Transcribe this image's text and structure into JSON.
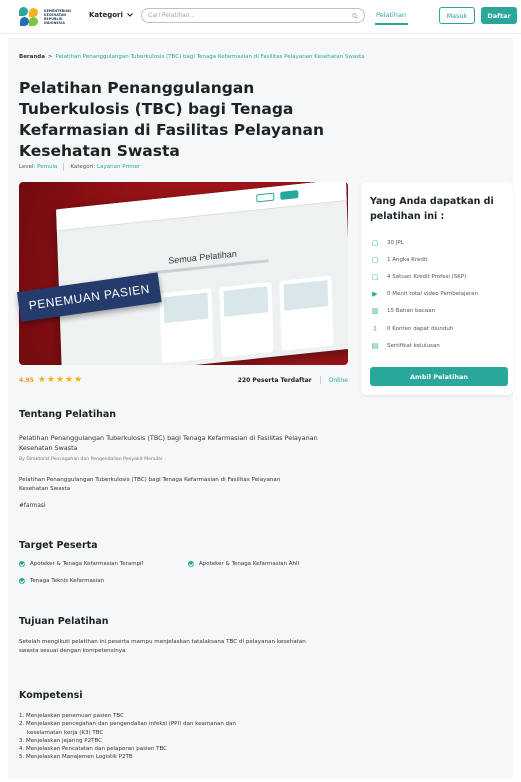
{
  "header": {
    "logo_lines": [
      "KEMENTERIAN",
      "KESEHATAN",
      "REPUBLIK",
      "INDONESIA"
    ],
    "kategori_label": "Kategori",
    "search_placeholder": "Cari Pelatihan...",
    "nav_pelatihan": "Pelatihan",
    "masuk": "Masuk",
    "daftar": "Daftar"
  },
  "breadcrumb": {
    "home": "Beranda",
    "separator": ">",
    "current": "Pelatihan Penanggulangan Tuberkulosis (TBC) bagi Tenaga Kefarmasian di Fasilitas Pelayanan Kesehatan Swasta"
  },
  "course": {
    "title": "Pelatihan Penanggulangan Tuberkulosis (TBC) bagi Tenaga Kefarmasian di Fasilitas Pelayanan Kesehatan Swasta",
    "level_label": "Level:",
    "level_value": "Pemula",
    "kategori_label": "Kategori:",
    "kategori_value": "Layanan Primer",
    "hero_label": "PENEMUAN PASIEN",
    "hero_board_title": "Semua Pelatihan",
    "rating": "4.95",
    "stars": "★★★★★",
    "peserta": "220 Peserta Terdaftar",
    "mode": "Online"
  },
  "side_card": {
    "title": "Yang Anda dapatkan di pelatihan ini :",
    "items": [
      {
        "icon": "doc-icon",
        "glyph": "▢",
        "label": "30 JPL"
      },
      {
        "icon": "doc-icon",
        "glyph": "▢",
        "label": "1 Angka Kredit"
      },
      {
        "icon": "doc-icon",
        "glyph": "▢",
        "label": "4 Satuan Kredit Profesi (SKP)"
      },
      {
        "icon": "play-icon",
        "glyph": "▶",
        "label": "0 Menit total video Pembelajaran"
      },
      {
        "icon": "book-icon",
        "glyph": "▥",
        "label": "15 Bahan bacaan"
      },
      {
        "icon": "download-icon",
        "glyph": "⇩",
        "label": "0 Konten dapat diunduh"
      },
      {
        "icon": "certificate-icon",
        "glyph": "▤",
        "label": "Sertifikat kelulusan"
      }
    ],
    "button": "Ambil Pelatihan"
  },
  "tentang": {
    "heading": "Tentang Pelatihan",
    "title": "Pelatihan Penanggulangan Tuberkulosis (TBC) bagi Tenaga Kefarmasian di Fasilitas Pelayanan Kesehatan Swasta",
    "by": "By Direktorat Pencegahan dan Pengendalian Penyakit Menular",
    "description": "Pelatihan Penanggulangan Tuberkulosis (TBC) bagi Tenaga Kefarmasian di Fasilitas Pelayanan Kesehatan Swasta",
    "tag": "#farmasi"
  },
  "target": {
    "heading": "Target Peserta",
    "items": [
      "Apoteker & Tenaga Kefarmasian Terampil",
      "Apoteker & Tenaga Kefarmasian Ahli",
      "Tenaga Teknis Kefarmasian"
    ]
  },
  "tujuan": {
    "heading": "Tujuan Pelatihan",
    "text": "Setelah mengikuti pelatihan ini peserta mampu menjelaskan tatalaksana TBC di pelayanan kesehatan swasta sesuai dengan kompetensinya"
  },
  "kompetensi": {
    "heading": "Kompetensi",
    "items": [
      "1. Menjelaskan penemuan pasien TBC",
      "2. Menjelaskan pencegahan dan pengendalian infeksi (PPI) dan keamanan dan",
      "    keselamatan kerja (K3) TBC",
      "3. Menjelaskan jejaring P2TBC",
      "4. Menjelaskan Pencatatan dan pelaporan pasien TBC",
      "5. Menjelaskan Manajemen Logistik P2TB"
    ]
  },
  "colors": {
    "accent": "#2aa79b",
    "hero_red": "#8c1014",
    "hero_label_bg": "#243b6b",
    "star": "#f2b01e"
  }
}
